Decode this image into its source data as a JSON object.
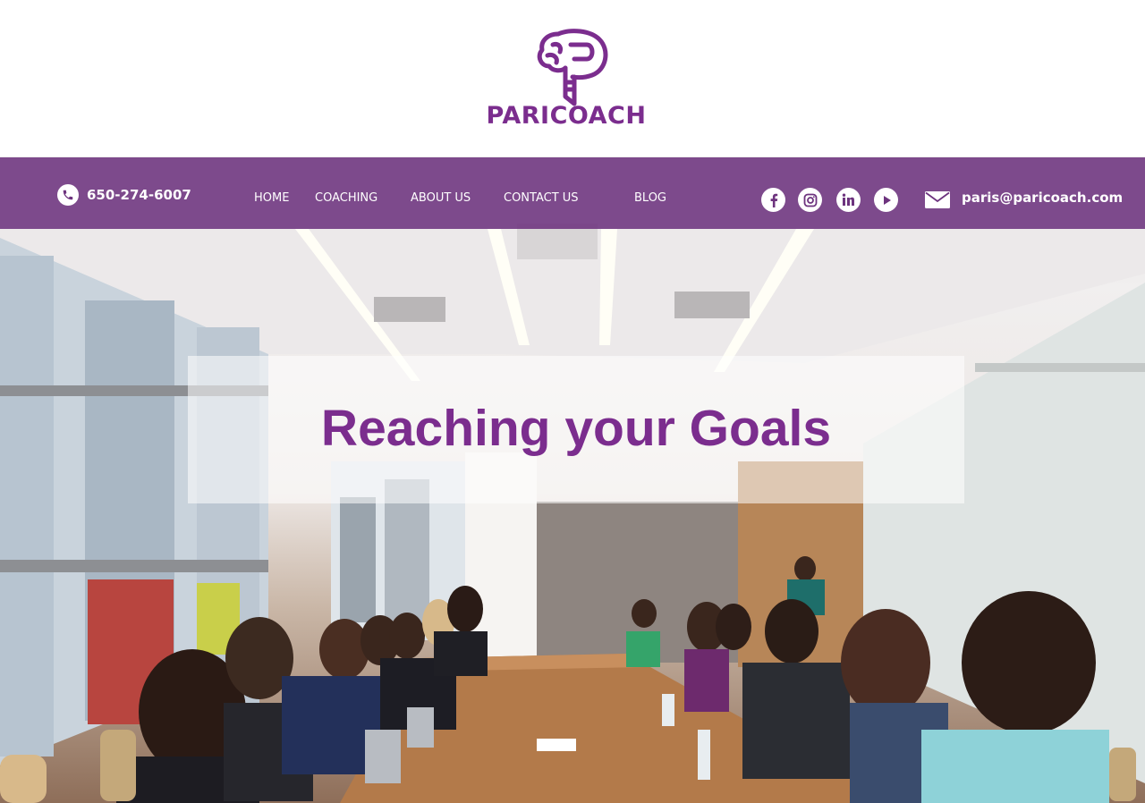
{
  "brand": {
    "name": "PARICOACH",
    "logo_icon": "brain-p-logo-icon",
    "color": "#7b2d8e"
  },
  "nav": {
    "phone": "650-274-6007",
    "links": [
      "HOME",
      "COACHING",
      "ABOUT US",
      "CONTACT  US",
      "BLOG"
    ],
    "email": "paris@paricoach.com",
    "social_icons": [
      "facebook-icon",
      "instagram-icon",
      "linkedin-icon",
      "youtube-play-icon"
    ],
    "bar_color": "#6d337e"
  },
  "hero": {
    "headline": "Reaching your Goals",
    "image": "office-meeting-conference-room-photo"
  }
}
